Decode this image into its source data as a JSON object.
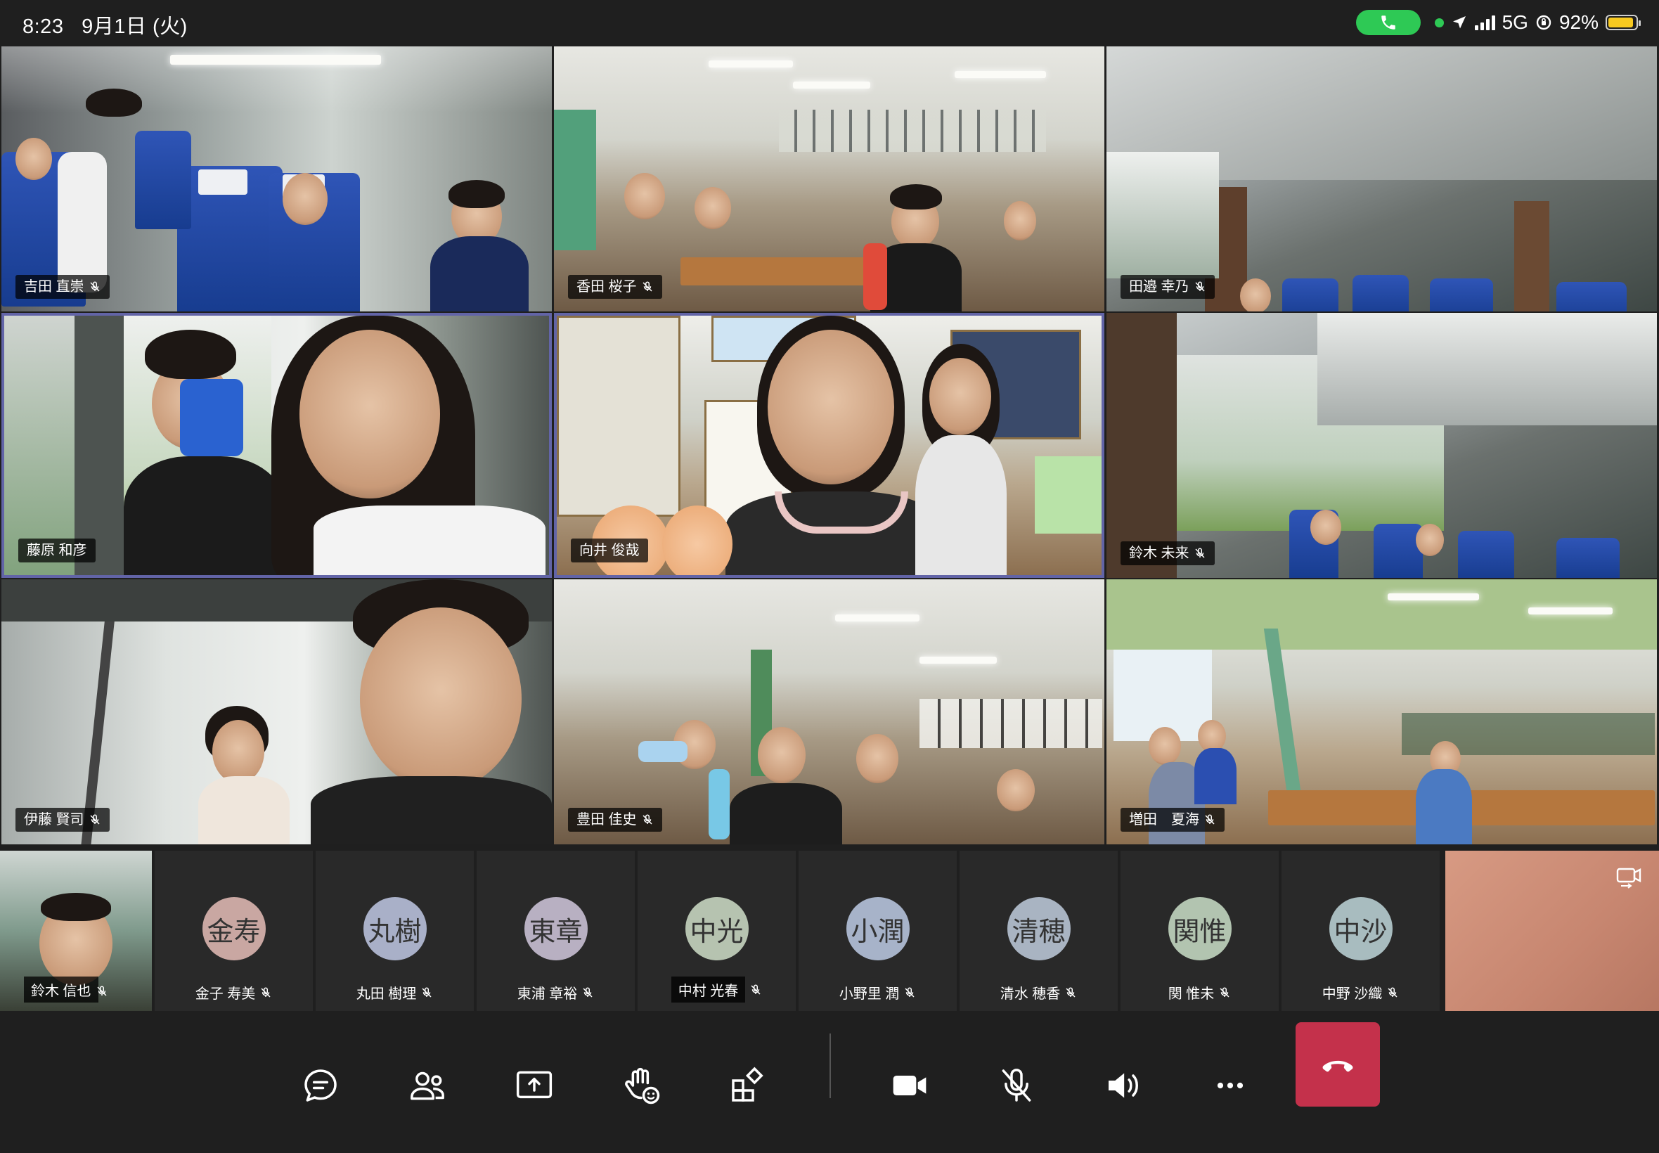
{
  "status_bar": {
    "time": "8:23",
    "date": "9月1日 (火)",
    "network": "5G",
    "battery": "92%",
    "battery_level": 0.92
  },
  "tiles": [
    {
      "name": "吉田 直崇",
      "scene": "bus"
    },
    {
      "name": "香田 桜子",
      "scene": "classroom"
    },
    {
      "name": "田邉 幸乃",
      "scene": "bus"
    },
    {
      "name": "藤原 和彦",
      "scene": "window"
    },
    {
      "name": "向井 俊哉",
      "scene": "classroom"
    },
    {
      "name": "鈴木 未来",
      "scene": "bus"
    },
    {
      "name": "伊藤 賢司",
      "scene": "window"
    },
    {
      "name": "豊田 佳史",
      "scene": "classroom"
    },
    {
      "name": "増田　夏海",
      "scene": "classroom"
    }
  ],
  "participants": [
    {
      "name": "鈴木 信也",
      "initials": "",
      "video": true
    },
    {
      "name": "金子 寿美",
      "initials": "金寿",
      "color": "#c9a7a2"
    },
    {
      "name": "丸田 樹理",
      "initials": "丸樹",
      "color": "#a9b0c8"
    },
    {
      "name": "東浦 章裕",
      "initials": "東章",
      "color": "#b8b0c2"
    },
    {
      "name": "中村 光春",
      "initials": "中光",
      "color": "#b6c3b0"
    },
    {
      "name": "小野里 潤",
      "initials": "小潤",
      "color": "#a7b3c9"
    },
    {
      "name": "清水 穂香",
      "initials": "清穂",
      "color": "#a9b4c2"
    },
    {
      "name": "関 惟未",
      "initials": "関惟",
      "color": "#b2c4b0"
    },
    {
      "name": "中野 沙織",
      "initials": "中沙",
      "color": "#a8bcbf"
    }
  ],
  "toolbar": {
    "icons": [
      "chat-icon",
      "people-icon",
      "share-screen-icon",
      "raise-hand-icon",
      "apps-icon",
      "camera-icon",
      "mic-off-icon",
      "speaker-icon",
      "more-icon",
      "hang-up-icon"
    ]
  },
  "colors": {
    "active_border": "#6264a7",
    "hangup": "#c4314b",
    "call_pill": "#2ec955"
  }
}
